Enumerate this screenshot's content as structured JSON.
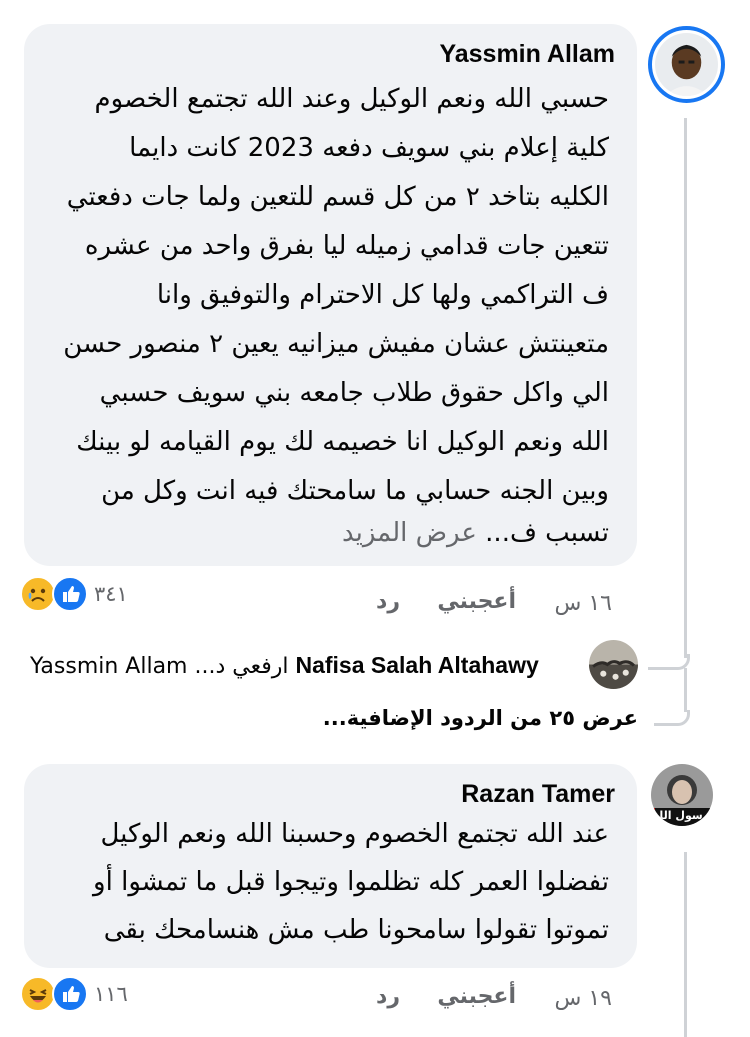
{
  "comments": [
    {
      "author": "Yassmin Allam",
      "lines": [
        "حسبي الله ونعم الوكيل وعند الله تجتمع الخصوم",
        "كلية إعلام بني سويف دفعه 2023 كانت دايما",
        "الكليه  بتاخد ٢ من كل قسم للتعين ولما جات دفعتي",
        "تتعين جات قدامي زميله ليا بفرق واحد من عشره",
        "ف التراكمي ولها كل الاحترام والتوفيق وانا",
        "متعينتش عشان مفيش ميزانيه يعين ٢ منصور حسن",
        "الي واكل حقوق طلاب جامعه بني سويف حسبي",
        "الله ونعم الوكيل انا خصيمه لك يوم القيامه لو بينك",
        "وبين الجنه حسابي ما سامحتك فيه انت وكل من"
      ],
      "last_line_text": "تسبب ف...",
      "see_more": "عرض المزيد",
      "time": "١٦ س",
      "like_label": "أعجبني",
      "reply_label": "رد",
      "reaction_count": "٣٤١"
    },
    {
      "author": "Razan Tamer",
      "avatar_caption": "رسول الله",
      "lines": [
        "عند الله تجتمع الخصوم وحسبنا الله ونعم الوكيل",
        "تفضلوا العمر كله تظلموا وتيجوا قبل ما تمشوا أو",
        "تموتوا تقولوا سامحونا طب مش هنسامحك بقى"
      ],
      "time": "١٩ س",
      "like_label": "أعجبني",
      "reply_label": "رد",
      "reaction_count": "١١٦"
    }
  ],
  "reply_preview": {
    "author": "Nafisa Salah Altahawy",
    "snippet": "ارفعي د...",
    "mention": "Yassmin Allam"
  },
  "view_more_replies": "عرض ٢٥ من الردود الإضافية...",
  "colors": {
    "bubble": "#f0f2f5",
    "meta_text": "#65676b",
    "like_blue": "#1877f2",
    "emoji_yellow": "#f7b928",
    "thread_line": "#cfd2d6"
  },
  "icons": [
    "like-reaction-icon",
    "sad-reaction-icon",
    "haha-reaction-icon"
  ]
}
